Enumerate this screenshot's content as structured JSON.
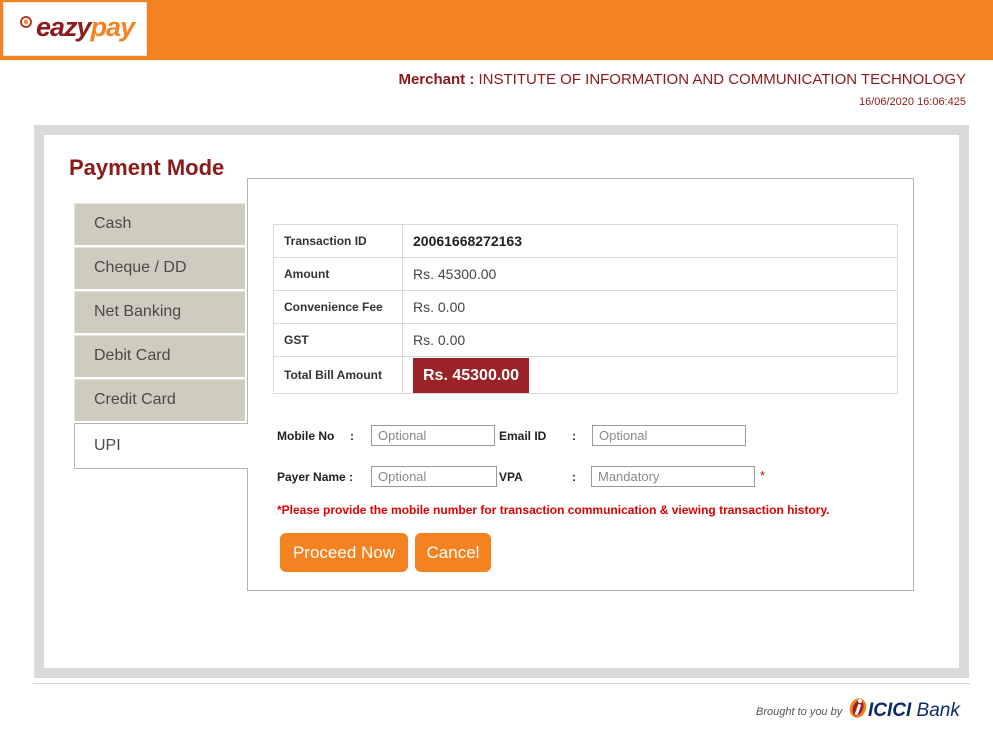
{
  "header": {
    "logo": {
      "part1": "eazy",
      "part2": "pay"
    },
    "merchant_label": "Merchant :",
    "merchant_name": "INSTITUTE OF INFORMATION AND COMMUNICATION TECHNOLOGY",
    "datetime": "16/06/2020 16:06:425",
    "bar_color": "#f58220"
  },
  "payment": {
    "title": "Payment Mode",
    "tabs": [
      {
        "label": "Cash"
      },
      {
        "label": "Cheque / DD"
      },
      {
        "label": "Net Banking"
      },
      {
        "label": "Debit Card"
      },
      {
        "label": "Credit Card"
      },
      {
        "label": "UPI",
        "active": true
      }
    ],
    "details": [
      {
        "label": "Transaction ID",
        "value": "20061668272163"
      },
      {
        "label": "Amount",
        "value": "Rs. 45300.00"
      },
      {
        "label": "Convenience Fee",
        "value": "Rs. 0.00"
      },
      {
        "label": "GST",
        "value": "Rs. 0.00"
      },
      {
        "label": "Total Bill Amount",
        "value": "Rs. 45300.00"
      }
    ],
    "form": {
      "mobile": {
        "label": "Mobile No",
        "colon": ":",
        "placeholder": "Optional"
      },
      "email": {
        "label": "Email ID",
        "colon": ":",
        "placeholder": "Optional"
      },
      "payer": {
        "label": "Payer Name :",
        "placeholder": "Optional"
      },
      "vpa": {
        "label": "VPA",
        "colon": ":",
        "placeholder": "Mandatory",
        "required_mark": "*"
      }
    },
    "note": "*Please provide the mobile number for transaction communication & viewing transaction history.",
    "buttons": {
      "proceed": "Proceed Now",
      "cancel": "Cancel"
    },
    "accent_color": "#8b1a1a"
  },
  "footer": {
    "brought_by": "Brought to you by",
    "bank_bold": "ICICI",
    "bank_rest": " Bank",
    "bank_icon": "icici-logo-icon"
  }
}
